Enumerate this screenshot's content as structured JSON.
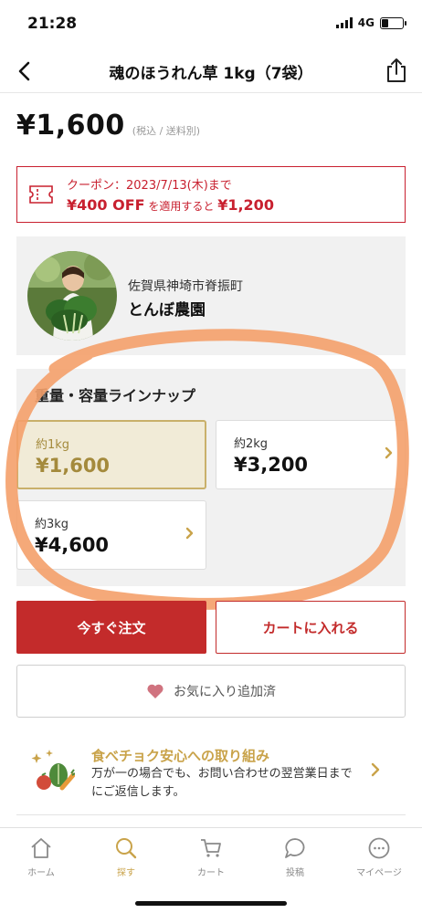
{
  "status_bar": {
    "time": "21:28",
    "network": "4G",
    "battery_level": 0.3,
    "icons": [
      "signal-icon",
      "battery-icon"
    ]
  },
  "nav": {
    "title": "魂のほうれん草 1kg（7袋）",
    "icons": [
      "back-arrow-icon",
      "share-icon"
    ]
  },
  "price": {
    "amount": "¥1,600",
    "note": "(税込 / 送料別)"
  },
  "coupon": {
    "line1": "クーポン：2023/7/13(木)まで",
    "discount": "¥400 OFF",
    "middle": " を適用すると ",
    "final_price": "¥1,200",
    "color": "#c8202f",
    "icon": "coupon-ticket-icon"
  },
  "producer": {
    "location": "佐賀県神埼市脊振町",
    "name": "とんぼ農園"
  },
  "lineup": {
    "title": "重量・容量ラインナップ",
    "options": [
      {
        "weight": "約1kg",
        "price": "¥1,600",
        "selected": true
      },
      {
        "weight": "約2kg",
        "price": "¥3,200",
        "selected": false
      },
      {
        "weight": "約3kg",
        "price": "¥4,600",
        "selected": false
      }
    ]
  },
  "actions": {
    "buy_now": "今すぐ注文",
    "add_to_cart": "カートに入れる",
    "favorite": "お気に入り追加済",
    "accent_color": "#c32b2b"
  },
  "safety": {
    "title": "食べチョク安心への取り組み",
    "text": "万が一の場合でも、お問い合わせの翌営業日までにご返信します。"
  },
  "tabbar": {
    "items": [
      {
        "label": "ホーム",
        "icon": "home-icon",
        "active": false
      },
      {
        "label": "探す",
        "icon": "search-icon",
        "active": true
      },
      {
        "label": "カート",
        "icon": "cart-icon",
        "active": false
      },
      {
        "label": "投稿",
        "icon": "chat-bubble-icon",
        "active": false
      },
      {
        "label": "マイページ",
        "icon": "mypage-icon",
        "active": false
      }
    ],
    "active_color": "#c9a34a"
  }
}
